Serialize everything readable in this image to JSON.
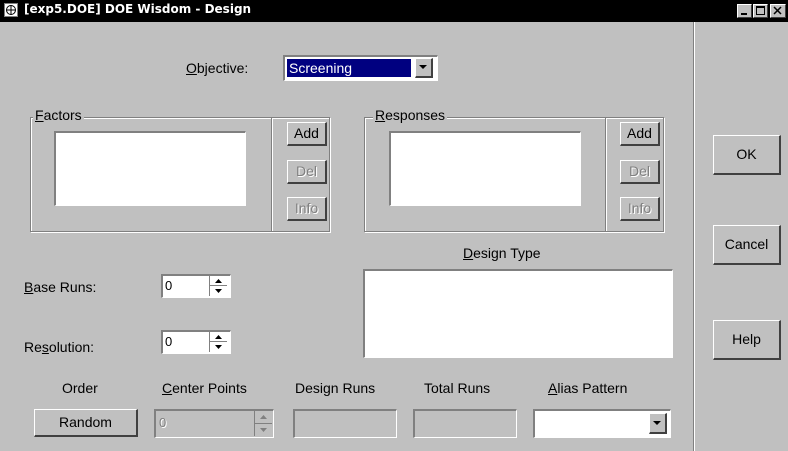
{
  "window": {
    "title": "[exp5.DOE] DOE Wisdom - Design"
  },
  "objective": {
    "label_prefix": "",
    "label_accel": "O",
    "label_rest": "bjective:",
    "value": "Screening"
  },
  "factors": {
    "legend_accel": "F",
    "legend_rest": "actors",
    "add": "Add",
    "del": "Del",
    "info": "Info"
  },
  "responses": {
    "legend_accel": "R",
    "legend_rest": "esponses",
    "add": "Add",
    "del": "Del",
    "info": "Info"
  },
  "design_type": {
    "label_accel": "D",
    "label_rest": "esign Type"
  },
  "base_runs": {
    "label_accel": "B",
    "label_rest": "ase Runs:",
    "value": "0"
  },
  "resolution": {
    "label_pre": "Re",
    "label_accel": "s",
    "label_rest": "olution:",
    "value": "0"
  },
  "columns": {
    "order": "Order",
    "center_points_accel": "C",
    "center_points_rest": "enter Points",
    "design_runs": "Design Runs",
    "total_runs": "Total Runs",
    "alias_pattern_accel": "A",
    "alias_pattern_rest": "lias Pattern"
  },
  "order_button": "Random",
  "center_points_value": "0",
  "side_buttons": {
    "ok": "OK",
    "cancel": "Cancel",
    "help": "Help"
  },
  "colors": {
    "face": "#c0c0c0",
    "titlebar": "#000000",
    "selection": "#000080"
  }
}
